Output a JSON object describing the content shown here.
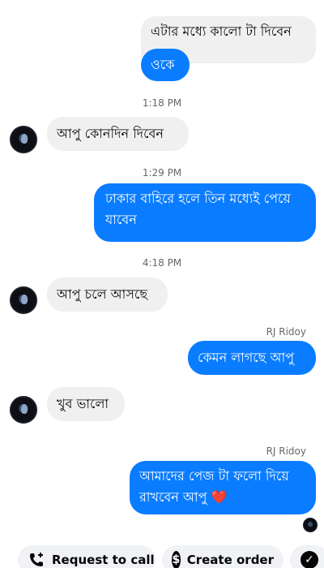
{
  "messages": [
    {
      "text": "এটার মধ্যে কালো টা দিবেন"
    },
    {
      "text": "ওকে"
    },
    {
      "text": "আপু কোনদিন দিবেন"
    },
    {
      "text": "ঢাকার বাহিরে হলে তিন মধ্যেই পেয়ে যাবেন"
    },
    {
      "text": "আপু চলে আসছে"
    },
    {
      "text": "কেমন লাগছে আপু"
    },
    {
      "text": "খুব ভালো"
    },
    {
      "text": "আমাদের পেজ টা ফলো দিয়ে রাখবেন আপু ❤️"
    }
  ],
  "timestamps": [
    "1:18 PM",
    "1:29 PM",
    "4:18 PM"
  ],
  "senders": [
    "RJ Ridoy",
    "RJ Ridoy"
  ],
  "actions": {
    "request_call": "Request to call",
    "create_order": "Create order",
    "call_icon": "phone-plus-icon",
    "order_icon": "dollar-icon",
    "confirm_icon": "check-icon"
  },
  "colors": {
    "outgoing": "#0a7cff",
    "incoming": "#f0f0f0"
  }
}
